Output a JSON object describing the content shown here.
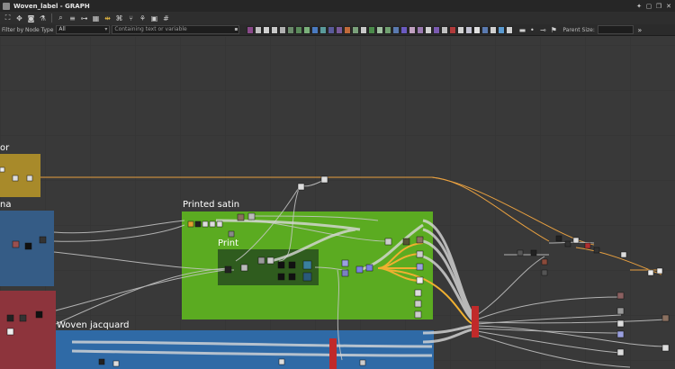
{
  "window": {
    "title": "Woven_label - GRAPH"
  },
  "filter": {
    "label": "Filter by Node Type",
    "type_value": "All",
    "search_placeholder": "Containing text or variable"
  },
  "parent_size": {
    "label": "Parent Size:"
  },
  "frames": {
    "frame_top_left": "or",
    "frame_mid_left": "na",
    "printed_satin": "Printed satin",
    "print": "Print",
    "woven_jacquard": "Woven jacquard"
  },
  "colors": {
    "background": "#393939",
    "frame_yellow": "#a88a2a",
    "frame_blue": "#355c86",
    "frame_red": "#8d343c",
    "frame_green": "#5bab21",
    "frame_dark_green": "#2f5c1e",
    "wire_orange": "#e8a040",
    "wire_gray": "#c8c8c8"
  },
  "toolbar_icons": [
    "frame-all-icon",
    "move-icon",
    "camera-icon",
    "graph-icon",
    "zoom-icon",
    "align-icon",
    "connect-icon",
    "table-icon",
    "link-icon",
    "shortcut-icon",
    "tree-icon",
    "snap-icon",
    "display-icon",
    "grid-icon"
  ],
  "node_type_icons": [
    "#8a4a8a",
    "#c0c0c0",
    "#d0d0d0",
    "#c8c8c8",
    "#b0b0b0",
    "#6a8a6a",
    "#5a8a5a",
    "#7ab07a",
    "#4a7ac0",
    "#5a9a9a",
    "#5a5a9a",
    "#7a5a9a",
    "#c06a3a",
    "#7aa07a",
    "#c8c8c8",
    "#4a8a4a",
    "#a0c0a0",
    "#70a070",
    "#5a7ab0",
    "#6a5ac0",
    "#c0a0c0",
    "#9a7ab0",
    "#d0d0d0",
    "#7a5ab0",
    "#c0c0c0",
    "#b03a3a",
    "#d0d0d0",
    "#c0c0d0",
    "#e0e0e0",
    "#5a7ab0",
    "#d0d0d0",
    "#5a9ad0",
    "#d0d0d0"
  ],
  "toolbar_right_icons": [
    "comment-icon",
    "pin-icon",
    "slider-icon",
    "flag-icon",
    "expand-icon"
  ]
}
